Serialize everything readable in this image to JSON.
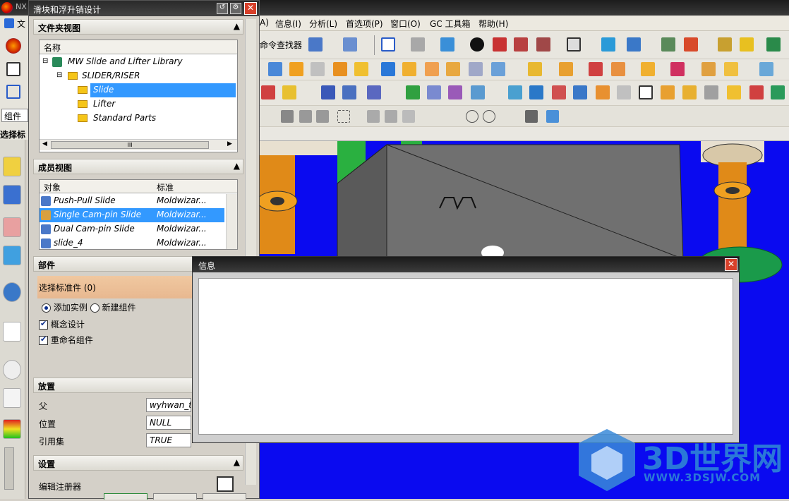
{
  "app": {
    "title": "NX"
  },
  "menubar": {
    "items": [
      "信息(I)",
      "分析(L)",
      "首选项(P)",
      "窗口(O)",
      "GC 工具箱",
      "帮助(H)"
    ]
  },
  "toolbar": {
    "command_finder": "命令查找器"
  },
  "left_labels": {
    "file_abbr": "文",
    "component_combo": "组件",
    "select_std": "选择标"
  },
  "dialog": {
    "title": "滑块和浮升销设计",
    "folder_view": {
      "header": "文件夹视图",
      "column": "名称",
      "tree": [
        "MW Slide and Lifter Library",
        "SLIDER/RISER",
        "Slide",
        "Lifter",
        "Standard Parts"
      ],
      "scroll_mark": "III"
    },
    "member_view": {
      "header": "成员视图",
      "columns": [
        "对象",
        "标准"
      ],
      "rows": [
        {
          "name": "Push-Pull Slide",
          "std": "Moldwizar..."
        },
        {
          "name": "Single Cam-pin Slide",
          "std": "Moldwizar..."
        },
        {
          "name": "Dual Cam-pin Slide",
          "std": "Moldwizar..."
        },
        {
          "name": "slide_4",
          "std": "Moldwizar..."
        }
      ]
    },
    "parts": {
      "header": "部件",
      "select": "选择标准件 (0)",
      "add_instance": "添加实例",
      "new_component": "新建组件",
      "concept_design": "概念设计",
      "rename": "重命名组件"
    },
    "placement": {
      "header": "放置",
      "parent_label": "父",
      "parent_value": "wyhwan_to",
      "position_label": "位置",
      "position_value": "NULL",
      "refset_label": "引用集",
      "refset_value": "TRUE"
    },
    "settings": {
      "header": "设置",
      "edit_registry": "编辑注册器"
    }
  },
  "info_window": {
    "title": "信息"
  },
  "watermark": {
    "brand": "3D世界网",
    "url": "WWW.3DSJW.COM"
  },
  "colors": {
    "viewport": "#0a0af0",
    "selection": "#3399ff",
    "titlebar": "#2a2a2a"
  }
}
